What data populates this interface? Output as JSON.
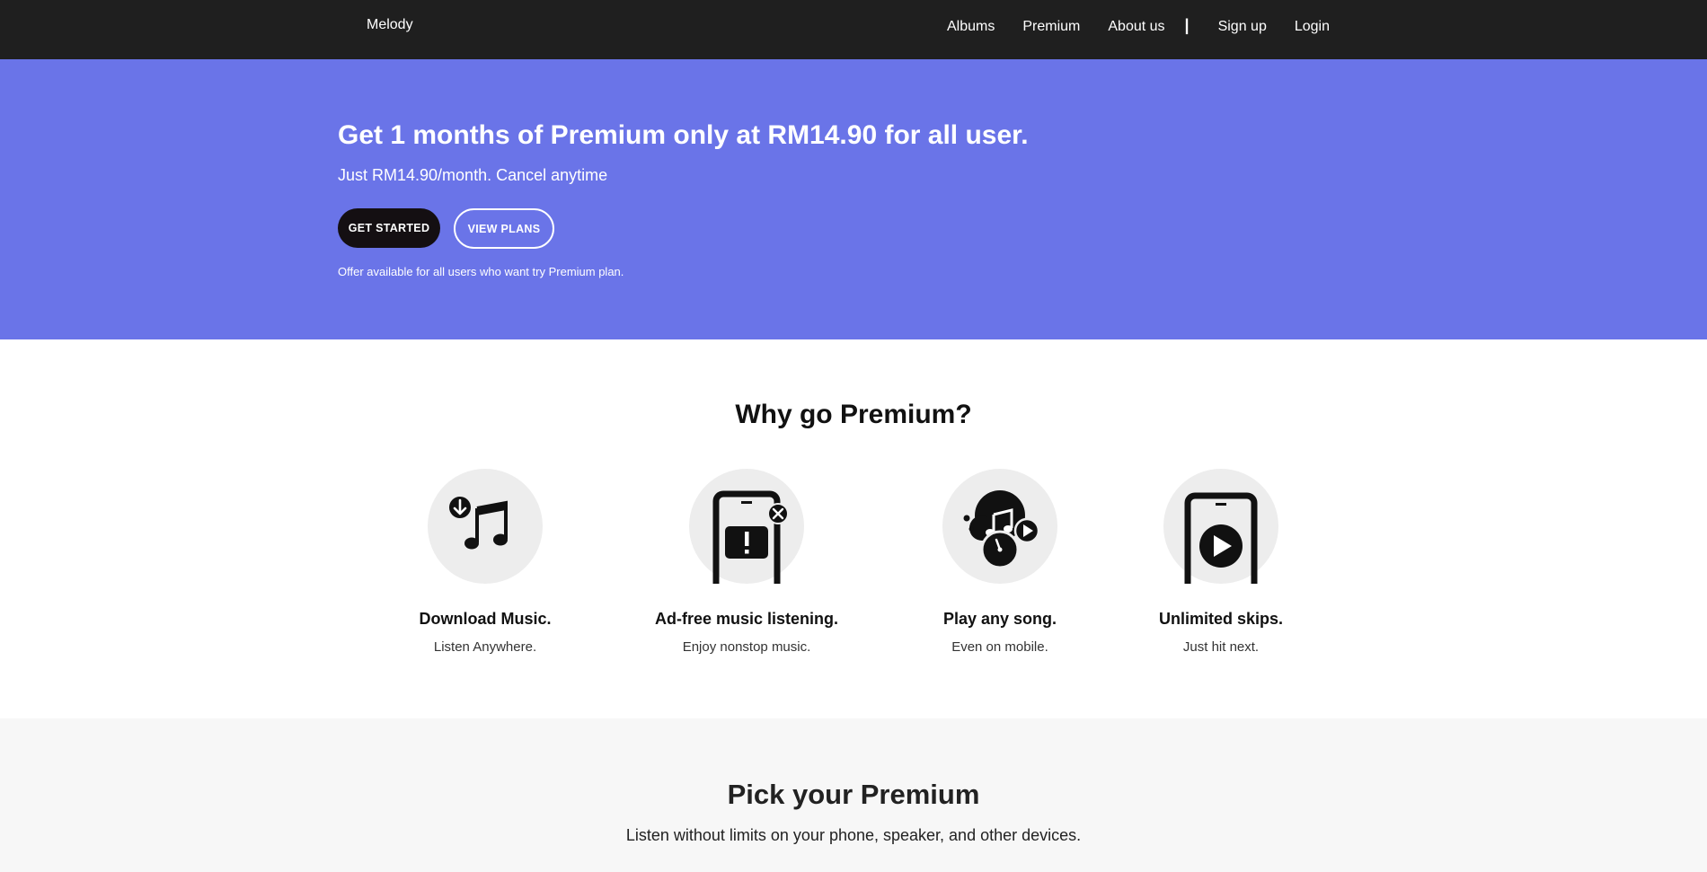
{
  "nav": {
    "brand": "Melody",
    "links": [
      "Albums",
      "Premium",
      "About us"
    ],
    "separator": "|",
    "signup": "Sign up",
    "login": "Login"
  },
  "hero": {
    "title": "Get 1 months of Premium only at RM14.90 for all user.",
    "subtitle": "Just RM14.90/month. Cancel anytime",
    "get_started": "GET STARTED",
    "view_plans": "VIEW PLANS",
    "note": "Offer available for all users who want try Premium plan."
  },
  "why": {
    "title": "Why go Premium?",
    "features": [
      {
        "icon": "download-music-icon",
        "title": "Download Music.",
        "desc": "Listen Anywhere."
      },
      {
        "icon": "ad-free-icon",
        "title": "Ad-free music listening.",
        "desc": "Enjoy nonstop music."
      },
      {
        "icon": "play-any-song-icon",
        "title": "Play any song.",
        "desc": "Even on mobile."
      },
      {
        "icon": "unlimited-skips-icon",
        "title": "Unlimited skips.",
        "desc": "Just hit next."
      }
    ]
  },
  "pick": {
    "title": "Pick your Premium",
    "subtitle": "Listen without limits on your phone, speaker, and other devices."
  },
  "colors": {
    "navbar": "#1f1f1f",
    "hero": "#6a74e8",
    "primary_button": "#140f12",
    "icon_circle": "#ededed",
    "pick_bg": "#f7f7f7"
  }
}
